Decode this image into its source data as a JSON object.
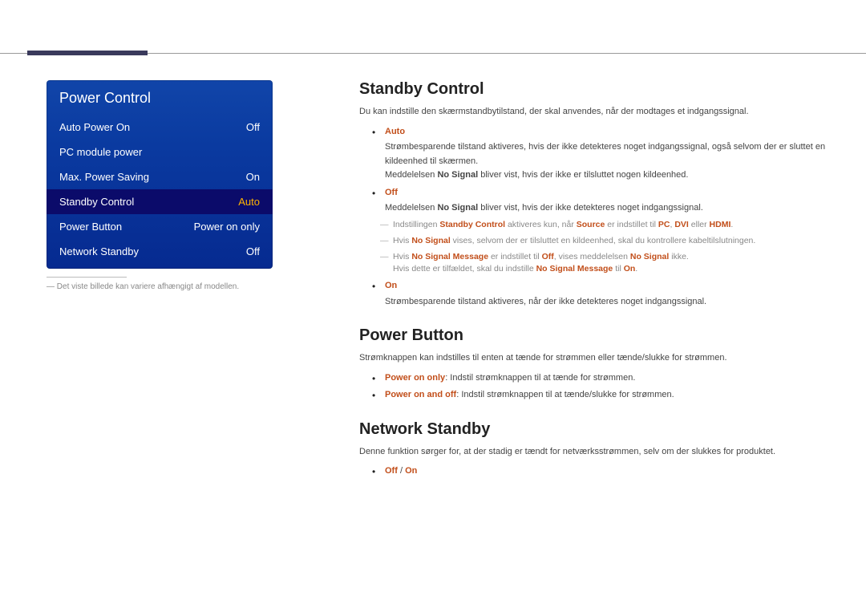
{
  "menu": {
    "title": "Power Control",
    "items": [
      {
        "label": "Auto Power On",
        "value": "Off"
      },
      {
        "label": "PC module power",
        "value": ""
      },
      {
        "label": "Max. Power Saving",
        "value": "On"
      },
      {
        "label": "Standby Control",
        "value": "Auto"
      },
      {
        "label": "Power Button",
        "value": "Power on only"
      },
      {
        "label": "Network Standby",
        "value": "Off"
      }
    ],
    "caption": "Det viste billede kan variere afhængigt af modellen."
  },
  "section1": {
    "heading": "Standby Control",
    "intro": "Du kan indstille den skærmstandbytilstand, der skal anvendes, når der modtages et indgangssignal.",
    "opt1_label": "Auto",
    "opt1_line1": "Strømbesparende tilstand aktiveres, hvis der ikke detekteres noget indgangssignal, også selvom der er sluttet en kildeenhed til skærmen.",
    "opt1_line2a": "Meddelelsen ",
    "opt1_line2b": "No Signal",
    "opt1_line2c": " bliver vist, hvis der ikke er tilsluttet nogen kildeenhed.",
    "opt2_label": "Off",
    "opt2_line1a": "Meddelelsen ",
    "opt2_line1b": "No Signal",
    "opt2_line1c": " bliver vist, hvis der ikke detekteres noget indgangssignal.",
    "opt2_note1_a": "Indstillingen ",
    "opt2_note1_b": "Standby Control",
    "opt2_note1_c": " aktiveres kun, når ",
    "opt2_note1_d": "Source",
    "opt2_note1_e": " er indstillet til ",
    "opt2_note1_f": "PC",
    "opt2_note1_g": ", ",
    "opt2_note1_h": "DVI",
    "opt2_note1_i": " eller ",
    "opt2_note1_j": "HDMI",
    "opt2_note1_k": ".",
    "opt2_note2_a": "Hvis ",
    "opt2_note2_b": "No Signal",
    "opt2_note2_c": " vises, selvom der er tilsluttet en kildeenhed, skal du kontrollere kabeltilslutningen.",
    "opt2_note3_a": "Hvis ",
    "opt2_note3_b": "No Signal Message",
    "opt2_note3_c": " er indstillet til ",
    "opt2_note3_d": "Off",
    "opt2_note3_e": ", vises meddelelsen ",
    "opt2_note3_f": "No Signal",
    "opt2_note3_g": " ikke.",
    "opt2_note3_line2_a": "Hvis dette er tilfældet, skal du indstille ",
    "opt2_note3_line2_b": "No Signal Message",
    "opt2_note3_line2_c": " til ",
    "opt2_note3_line2_d": "On",
    "opt2_note3_line2_e": ".",
    "opt3_label": "On",
    "opt3_line": "Strømbesparende tilstand aktiveres, når der ikke detekteres noget indgangssignal."
  },
  "section2": {
    "heading": "Power Button",
    "intro": "Strømknappen kan indstilles til enten at tænde for strømmen eller tænde/slukke for strømmen.",
    "opt1_b": "Power on only",
    "opt1_t": ": Indstil strømknappen til at tænde for strømmen.",
    "opt2_b": "Power on and off",
    "opt2_t": ": Indstil strømknappen til at tænde/slukke for strømmen."
  },
  "section3": {
    "heading": "Network Standby",
    "intro": "Denne funktion sørger for, at der stadig er tændt for netværksstrømmen, selv om der slukkes for produktet.",
    "opts_a": "Off",
    "opts_sep": " / ",
    "opts_b": "On"
  }
}
